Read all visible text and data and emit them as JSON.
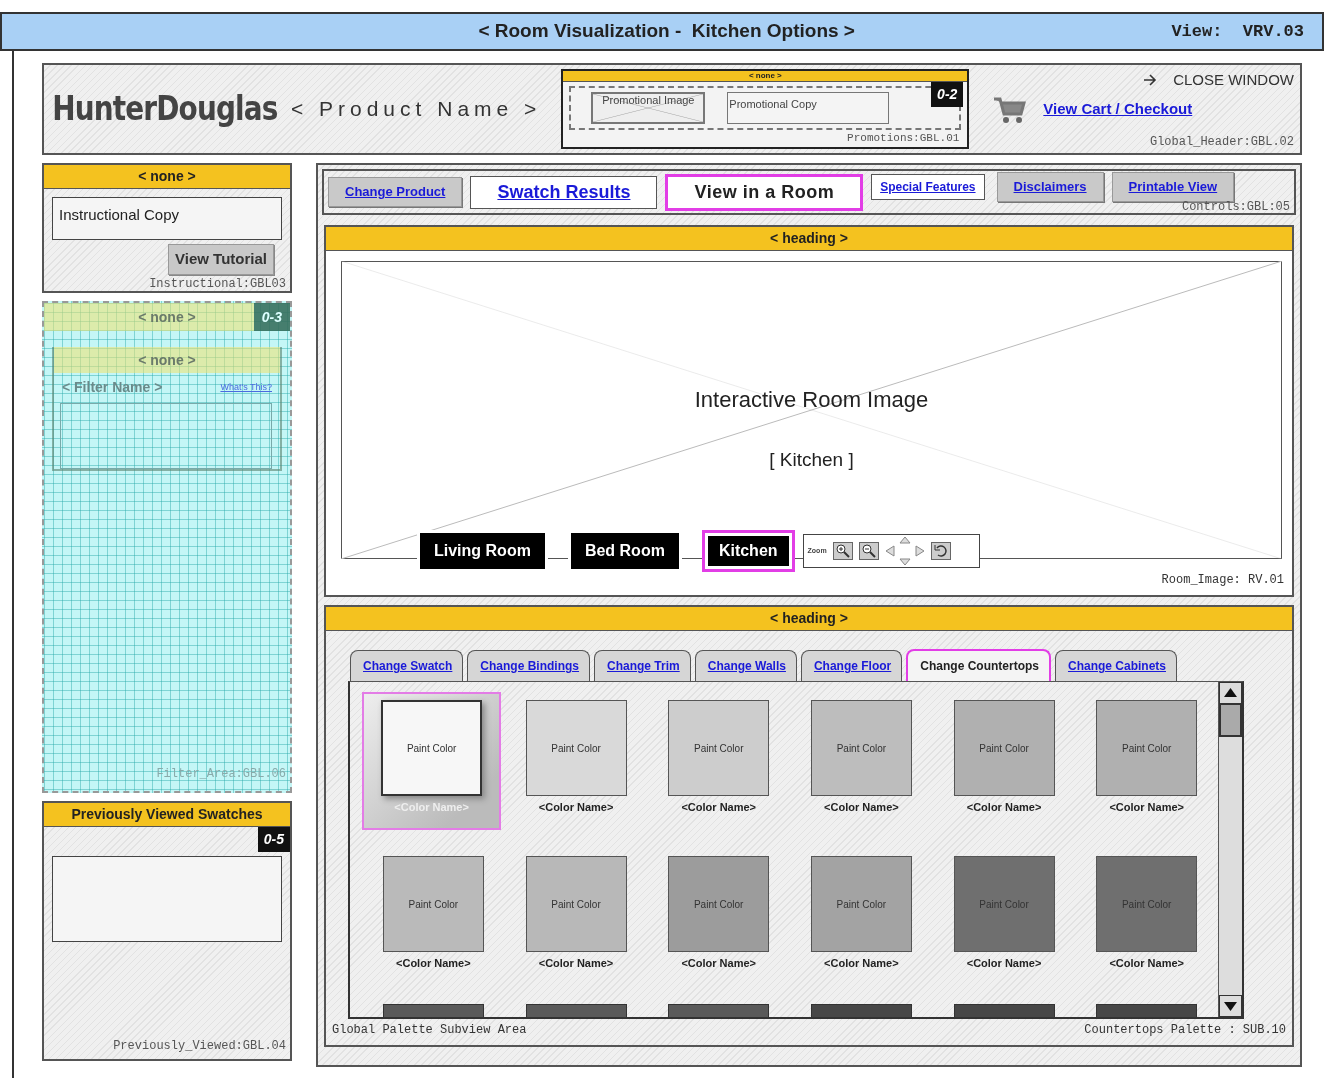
{
  "title_bar": {
    "title": "< Room Visualization -  Kitchen Options >",
    "view": "View:  VRV.03"
  },
  "header": {
    "logo": "HunterDouglas",
    "product_name": "< Product Name >",
    "promotions": {
      "heading": "< none >",
      "image_label": "Promotional Image",
      "copy": "Promotional Copy",
      "badge": "0-2",
      "label": "Promotions:GBL.01"
    },
    "close_window": "CLOSE WINDOW",
    "cart_link": "View Cart / Checkout",
    "label": "Global_Header:GBL.02"
  },
  "instructional": {
    "heading": "< none >",
    "copy": "Instructional Copy",
    "button": "View Tutorial",
    "label": "Instructional:GBL03"
  },
  "filter_area": {
    "heading": "< none >",
    "badge": "0-3",
    "subheading": "< none >",
    "filter_name": "< Filter Name >",
    "help_link": "What's This?",
    "label": "Filter_Area:GBL.06"
  },
  "previously_viewed": {
    "heading": "Previously Viewed Swatches",
    "badge": "0-5",
    "label": "Previously_Viewed:GBL.04"
  },
  "controls": {
    "items": [
      {
        "label": "Change Product",
        "kind": "raised",
        "selected": false
      },
      {
        "label": "Swatch Results",
        "kind": "flat-large",
        "selected": false
      },
      {
        "label": "View in a Room",
        "kind": "flat-large",
        "selected": true
      },
      {
        "label": "Special Features",
        "kind": "flat",
        "selected": false
      },
      {
        "label": "Disclaimers",
        "kind": "raised",
        "selected": false
      },
      {
        "label": "Printable View",
        "kind": "raised",
        "selected": false
      }
    ],
    "label": "Controls:GBL:05"
  },
  "room_image": {
    "heading": "< heading >",
    "title": "Interactive Room Image",
    "subtitle": "[ Kitchen ]",
    "rooms": [
      {
        "label": "Living Room",
        "selected": false
      },
      {
        "label": "Bed Room",
        "selected": false
      },
      {
        "label": "Kitchen",
        "selected": true
      }
    ],
    "zoom_label": "Zoom",
    "label": "Room_Image: RV.01"
  },
  "palette": {
    "heading": "< heading >",
    "tabs": [
      {
        "label": "Change Swatch",
        "selected": false
      },
      {
        "label": "Change Bindings",
        "selected": false
      },
      {
        "label": "Change Trim",
        "selected": false
      },
      {
        "label": "Change Walls",
        "selected": false
      },
      {
        "label": "Change Floor",
        "selected": false
      },
      {
        "label": "Change Countertops",
        "selected": true
      },
      {
        "label": "Change Cabinets",
        "selected": false
      }
    ],
    "swatches": [
      {
        "label": "Paint Color",
        "name": "<Color Name>",
        "color": "#f7f7f7",
        "selected": true
      },
      {
        "label": "Paint Color",
        "name": "<Color Name>",
        "color": "#d9d9d9",
        "selected": false
      },
      {
        "label": "Paint Color",
        "name": "<Color Name>",
        "color": "#cdcdcd",
        "selected": false
      },
      {
        "label": "Paint Color",
        "name": "<Color Name>",
        "color": "#bdbdbd",
        "selected": false
      },
      {
        "label": "Paint Color",
        "name": "<Color Name>",
        "color": "#b0b0b0",
        "selected": false
      },
      {
        "label": "Paint Color",
        "name": "<Color Name>",
        "color": "#b0b0b0",
        "selected": false
      },
      {
        "label": "Paint Color",
        "name": "<Color Name>",
        "color": "#bababa",
        "selected": false
      },
      {
        "label": "Paint Color",
        "name": "<Color Name>",
        "color": "#b8b8b8",
        "selected": false
      },
      {
        "label": "Paint Color",
        "name": "<Color Name>",
        "color": "#9c9c9c",
        "selected": false
      },
      {
        "label": "Paint Color",
        "name": "<Color Name>",
        "color": "#a3a3a3",
        "selected": false
      },
      {
        "label": "Paint Color",
        "name": "<Color Name>",
        "color": "#6f6f6f",
        "selected": false
      },
      {
        "label": "Paint Color",
        "name": "<Color Name>",
        "color": "#6f6f6f",
        "selected": false
      }
    ],
    "partial_swatches": [
      {
        "color": "#5a5a5a"
      },
      {
        "color": "#5a5a5a"
      },
      {
        "color": "#5a5a5a"
      },
      {
        "color": "#474747"
      },
      {
        "color": "#474747"
      },
      {
        "color": "#474747"
      }
    ],
    "footer_left": "Global Palette Subview Area",
    "footer_right": "Countertops Palette : SUB.10"
  }
}
